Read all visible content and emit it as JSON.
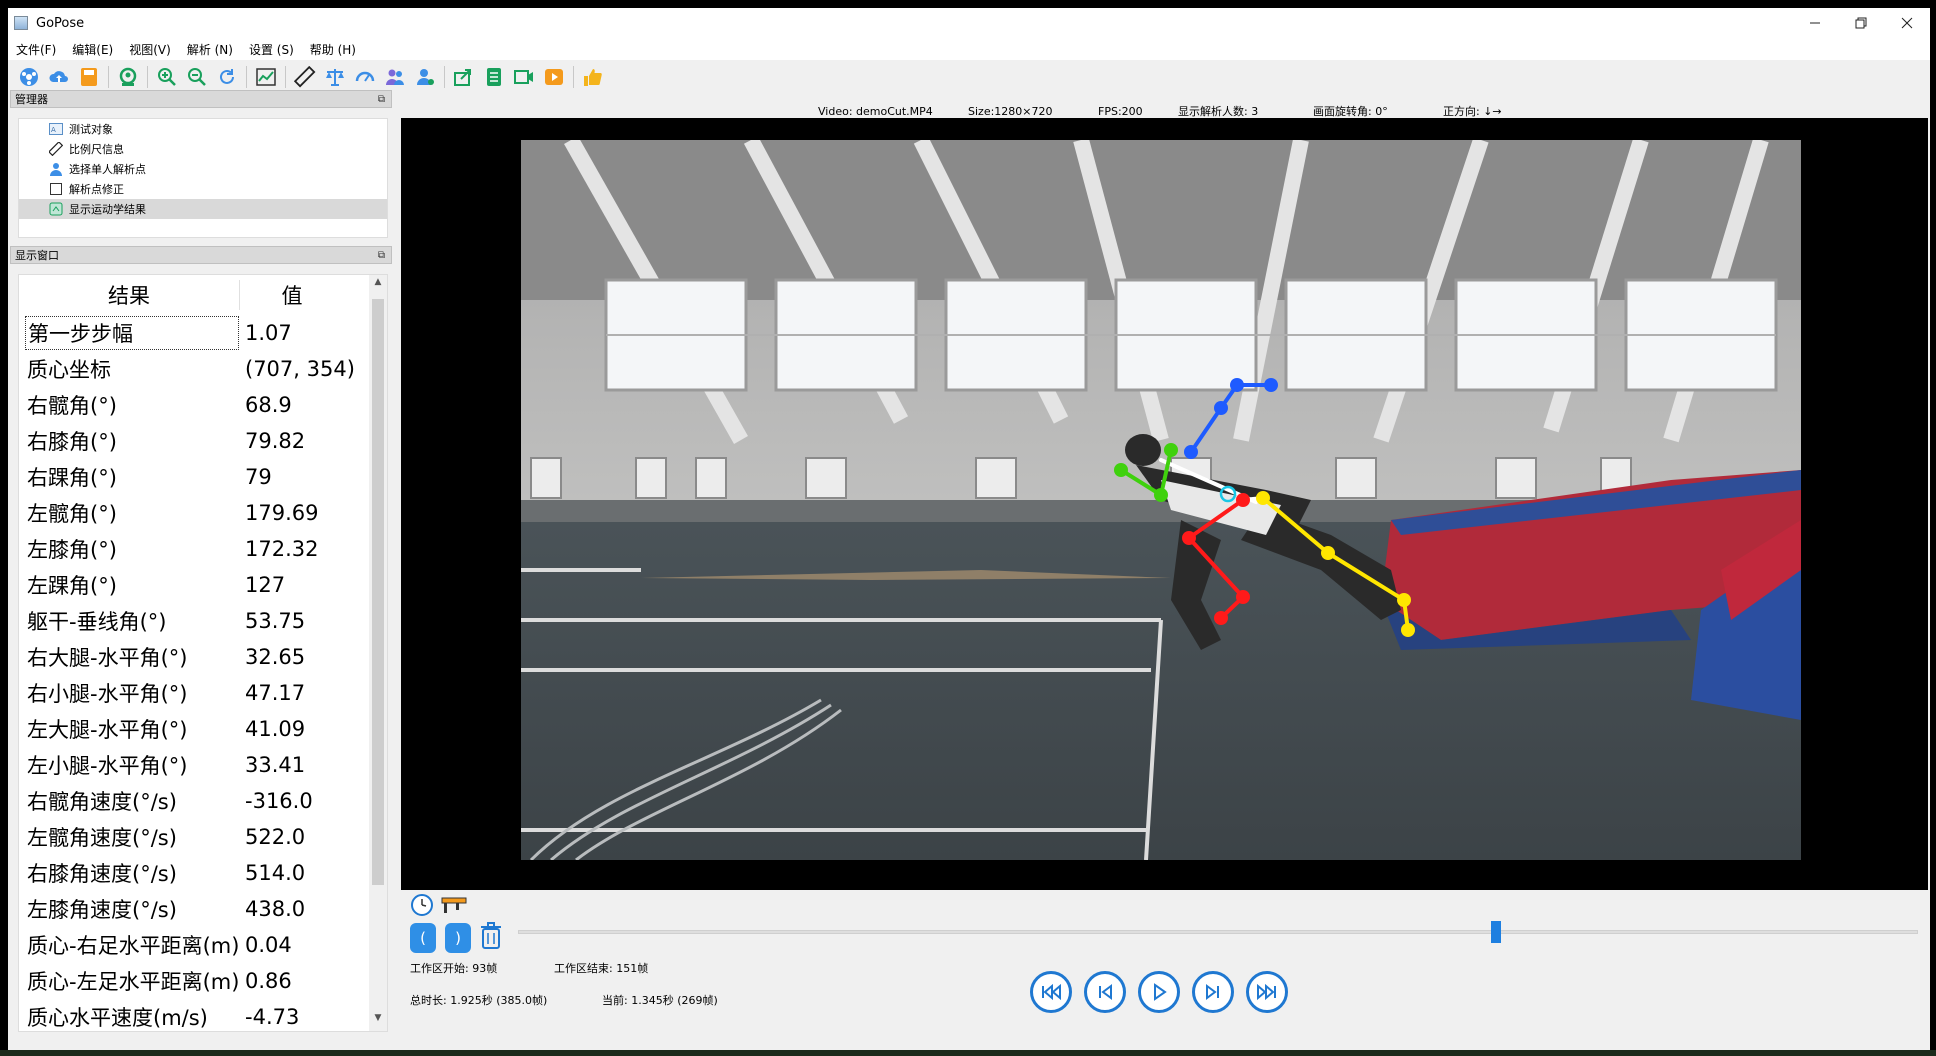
{
  "window": {
    "title": "GoPose"
  },
  "menu": [
    "文件(F)",
    "编辑(E)",
    "视图(V)",
    "解析 (N)",
    "设置 (S)",
    "帮助 (H)"
  ],
  "toolbar": {
    "icons": [
      "open-video-icon",
      "cloud-upload-icon",
      "save-icon",
      "keypoint-detect-icon",
      "zoom-in-icon",
      "zoom-out-icon",
      "rotate-icon",
      "chart-icon",
      "ruler-icon",
      "balance-icon",
      "gauge-icon",
      "multi-person-icon",
      "single-person-icon",
      "export-icon",
      "export-data-icon",
      "export-video-icon",
      "export-gif-icon",
      "like-icon"
    ]
  },
  "manager": {
    "title": "管理器",
    "items": [
      {
        "label": "测试对象",
        "icon": "test-object-icon",
        "selected": false
      },
      {
        "label": "比例尺信息",
        "icon": "ruler-icon",
        "selected": false
      },
      {
        "label": "选择单人解析点",
        "icon": "person-icon",
        "selected": false
      },
      {
        "label": "解析点修正",
        "icon": "checkbox-icon",
        "selected": false
      },
      {
        "label": "显示运动学结果",
        "icon": "kinematics-icon",
        "selected": true
      }
    ]
  },
  "display_window": {
    "title": "显示窗口",
    "col_result": "结果",
    "col_value": "值",
    "rows": [
      {
        "name": "第一步步幅",
        "value": "1.07"
      },
      {
        "name": "质心坐标",
        "value": "(707, 354)"
      },
      {
        "name": "右髋角(°)",
        "value": "68.9"
      },
      {
        "name": "右膝角(°)",
        "value": "79.82"
      },
      {
        "name": "右踝角(°)",
        "value": "79"
      },
      {
        "name": "左髋角(°)",
        "value": "179.69"
      },
      {
        "name": "左膝角(°)",
        "value": "172.32"
      },
      {
        "name": "左踝角(°)",
        "value": "127"
      },
      {
        "name": "躯干-垂线角(°)",
        "value": "53.75"
      },
      {
        "name": "右大腿-水平角(°)",
        "value": "32.65"
      },
      {
        "name": "右小腿-水平角(°)",
        "value": "47.17"
      },
      {
        "name": "左大腿-水平角(°)",
        "value": "41.09"
      },
      {
        "name": "左小腿-水平角(°)",
        "value": "33.41"
      },
      {
        "name": "右髋角速度(°/s)",
        "value": "-316.0"
      },
      {
        "name": "左髋角速度(°/s)",
        "value": "522.0"
      },
      {
        "name": "右膝角速度(°/s)",
        "value": "514.0"
      },
      {
        "name": "左膝角速度(°/s)",
        "value": "438.0"
      },
      {
        "name": "质心-右足水平距离(m)",
        "value": "0.04"
      },
      {
        "name": "质心-左足水平距离(m)",
        "value": "0.86"
      },
      {
        "name": "质心水平速度(m/s)",
        "value": "-4.73"
      }
    ]
  },
  "info": {
    "video": "Video: demoCut.MP4",
    "size": "Size:1280×720",
    "fps": "FPS:200",
    "persons": "显示解析人数: 3",
    "rotation": "画面旋转角: 0°",
    "direction": "正方向: ↓→"
  },
  "controls": {
    "bracket_open": "(",
    "bracket_close": ")",
    "slider_position": 0.6986,
    "work_start": "工作区开始: 93帧",
    "work_end": "工作区结束: 151帧",
    "total": "总时长: 1.925秒 (385.0帧)",
    "current": "当前: 1.345秒 (269帧)"
  },
  "colors": {
    "right_leg": "#ff1a1a",
    "left_leg": "#ffe600",
    "right_arm": "#1e5bff",
    "left_arm": "#3fd10d",
    "torso": "#ffffff",
    "accent": "#1f78d1"
  }
}
